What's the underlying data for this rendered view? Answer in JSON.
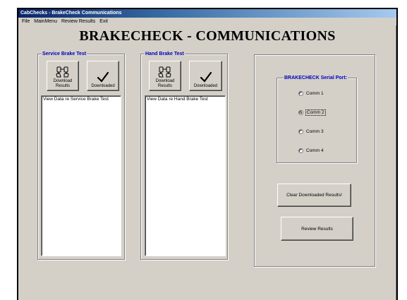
{
  "window": {
    "title": "CabChecks - BrakeCheck Communications"
  },
  "menu": [
    "File",
    "MainMenu",
    "Review Results",
    "Exit"
  ],
  "heading": "BRAKECHECK - COMMUNICATIONS",
  "service_panel": {
    "label": "Service Brake Test",
    "download_button": "Download Results",
    "downloaded_button": "Downloaded",
    "list_items": [
      "View Data re Service Brake Test"
    ]
  },
  "hand_panel": {
    "label": "Hand Brake Test",
    "download_button": "Download Results",
    "downloaded_button": "Downloaded",
    "list_items": [
      "View Data re Hand Brake Test"
    ]
  },
  "serial_port": {
    "label": "BRAKECHECK Serial Port:",
    "options": [
      "Comm 1",
      "Comm 2",
      "Comm 3",
      "Comm 4"
    ],
    "selected": "Comm 2"
  },
  "actions": {
    "clear_button": "Clear Downloaded Results!",
    "review_button": "Review Results"
  },
  "colors": {
    "window_bg": "#d4d0c8",
    "group_label": "#0000c0",
    "titlebar_start": "#0a246a"
  },
  "icons": {
    "download": "hand-download-icon",
    "downloaded": "checkmark-icon"
  }
}
